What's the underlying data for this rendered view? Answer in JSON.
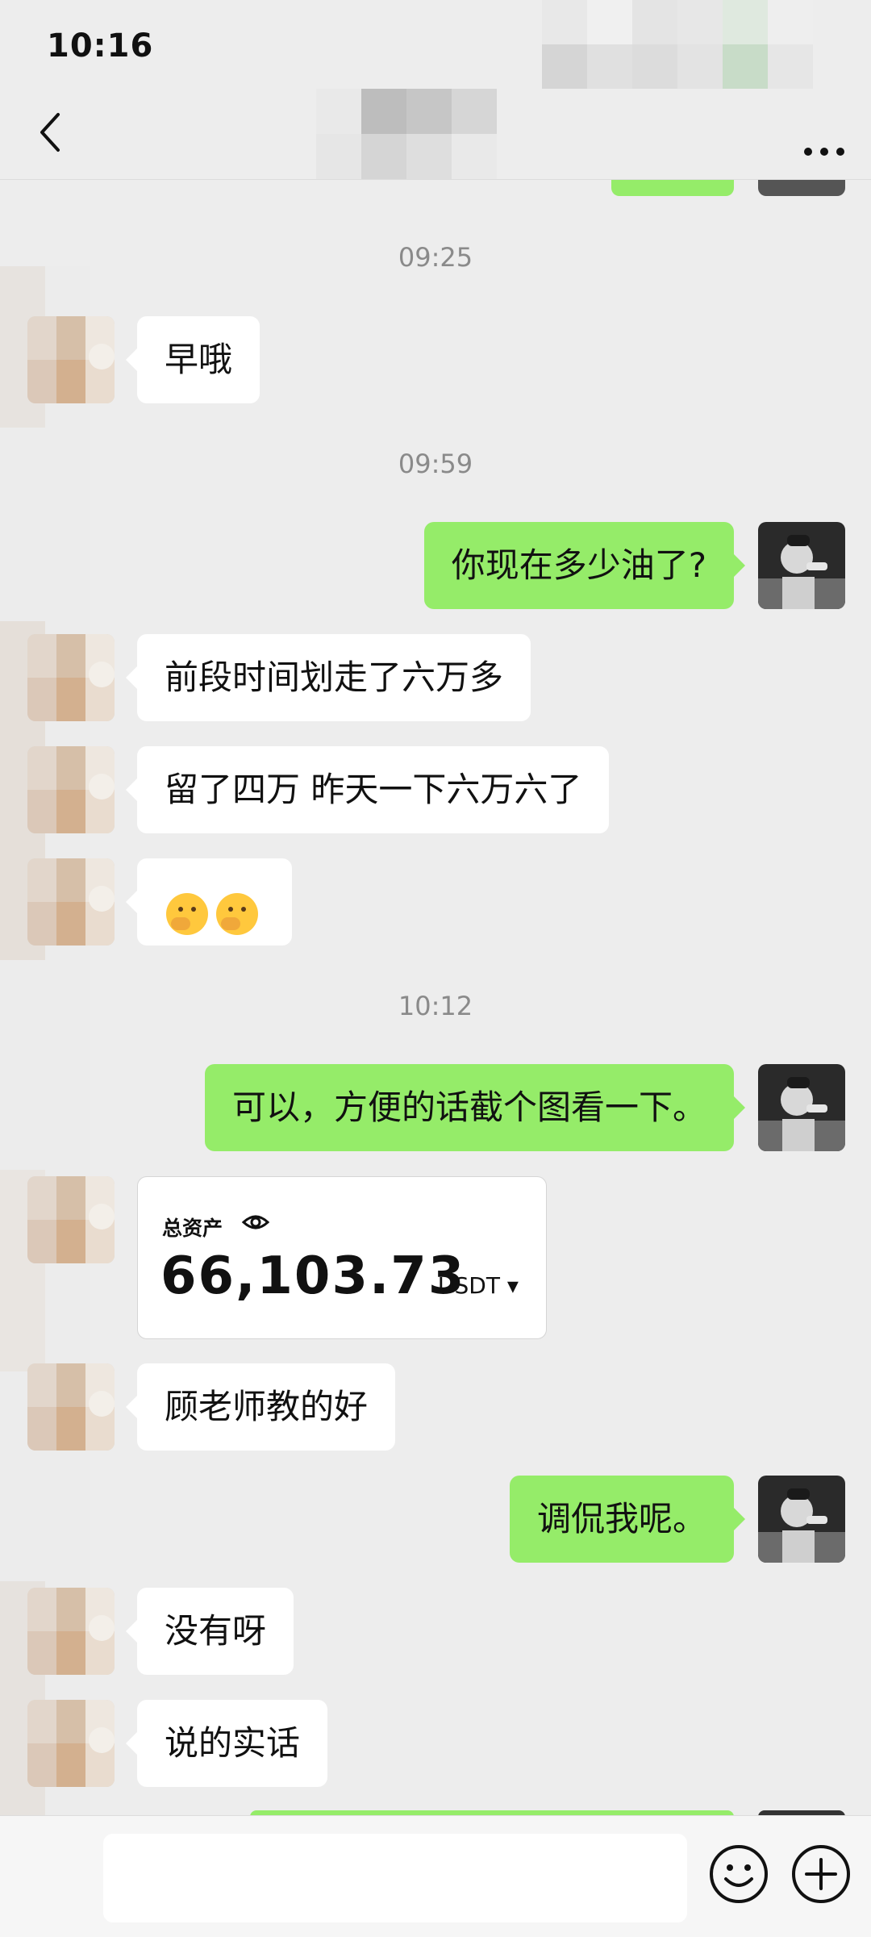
{
  "status_bar": {
    "time": "10:16"
  },
  "header": {
    "back_icon": "chevron-left-icon",
    "more_icon": "more-dots-icon"
  },
  "messages": {
    "ts1": "09:25",
    "m1": "早哦",
    "ts2": "09:59",
    "m2": "你现在多少油了?",
    "m3": "前段时间划走了六万多",
    "m4": "留了四万 昨天一下六万六了",
    "ts3": "10:12",
    "m6": "可以，方便的话截个图看一下。",
    "m8": "顾老师教的好",
    "m9": "调侃我呢。",
    "m10": "没有呀",
    "m11": "说的实话"
  },
  "asset_card": {
    "label": "总资产",
    "value": "66,103.73",
    "unit": "USDT ▾"
  },
  "input_bar": {
    "emoji_icon": "smiley-icon",
    "plus_icon": "plus-circle-icon"
  },
  "colors": {
    "background": "#ededed",
    "self_bubble": "#95ec69",
    "other_bubble": "#ffffff"
  }
}
